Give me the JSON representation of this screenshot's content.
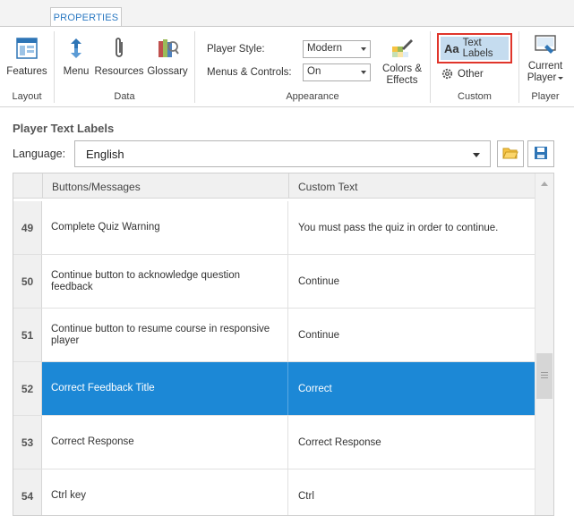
{
  "ribbon": {
    "tab": "PROPERTIES",
    "groups": {
      "layout": {
        "label": "Layout",
        "features": "Features"
      },
      "data": {
        "label": "Data",
        "menu": "Menu",
        "resources": "Resources",
        "glossary": "Glossary"
      },
      "appearance": {
        "label": "Appearance",
        "player_style_label": "Player Style:",
        "player_style_value": "Modern",
        "menus_controls_label": "Menus & Controls:",
        "menus_controls_value": "On",
        "colors_effects_line1": "Colors &",
        "colors_effects_line2": "Effects"
      },
      "custom": {
        "label": "Custom",
        "text_labels": "Text Labels",
        "text_labels_icon": "Aa",
        "other": "Other"
      },
      "player": {
        "label": "Player",
        "current_line1": "Current",
        "current_line2": "Player"
      }
    }
  },
  "panel": {
    "title": "Player Text Labels",
    "language_label": "Language:",
    "language_value": "English"
  },
  "table": {
    "headers": {
      "col1": "Buttons/Messages",
      "col2": "Custom Text"
    },
    "rows": [
      {
        "num": "49",
        "message": "Complete Quiz Warning",
        "custom": "You must pass the quiz in order to continue.",
        "selected": false
      },
      {
        "num": "50",
        "message": "Continue button to acknowledge question feedback",
        "custom": "Continue",
        "selected": false
      },
      {
        "num": "51",
        "message": "Continue button to resume course in responsive player",
        "custom": "Continue",
        "selected": false
      },
      {
        "num": "52",
        "message": "Correct Feedback Title",
        "custom": "Correct",
        "selected": true
      },
      {
        "num": "53",
        "message": "Correct Response",
        "custom": "Correct Response",
        "selected": false
      },
      {
        "num": "54",
        "message": "Ctrl key",
        "custom": "Ctrl",
        "selected": false
      }
    ]
  },
  "colors": {
    "accent": "#2b79c2",
    "selected_row": "#1c88d6",
    "highlight_border": "#e0352b",
    "text_labels_bg": "#c5dcef"
  }
}
